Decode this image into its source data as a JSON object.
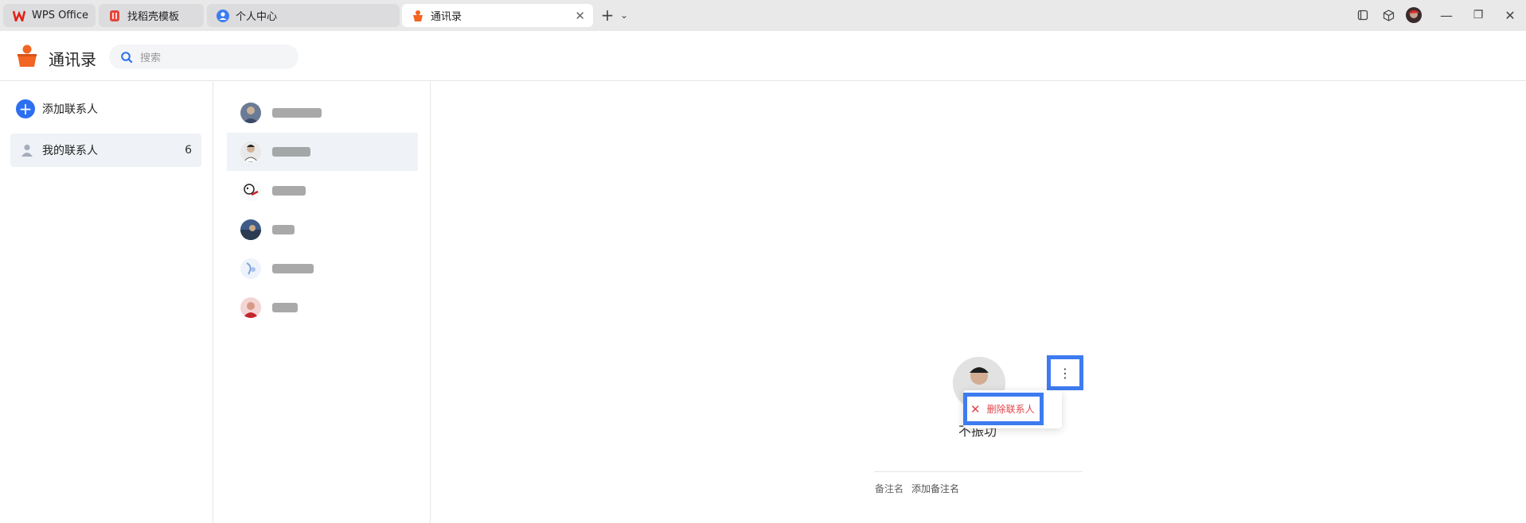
{
  "titlebar": {
    "tabs": [
      {
        "label": "WPS Office",
        "icon": "wps-logo-icon"
      },
      {
        "label": "找稻壳模板",
        "icon": "docer-icon"
      },
      {
        "label": "个人中心",
        "icon": "user-center-icon"
      },
      {
        "label": "通讯录",
        "icon": "contacts-app-icon",
        "active": true
      }
    ],
    "new_tab": "+",
    "dropdown": "⌄",
    "controls": {
      "minimize": "—",
      "restore": "❐",
      "close": "✕"
    }
  },
  "header": {
    "app_title": "通讯录",
    "search_placeholder": "搜索"
  },
  "sidebar": {
    "add_contact": "添加联系人",
    "my_contacts": "我的联系人",
    "my_contacts_count": "6"
  },
  "contacts": {
    "count": 6,
    "selected_index": 1
  },
  "detail": {
    "name": "不振功",
    "more_icon": "⋮",
    "menu": {
      "delete": "删除联系人"
    },
    "remark_label": "备注名",
    "remark_add": "添加备注名"
  },
  "colors": {
    "accent": "#2c6ff0",
    "highlight": "#3d7bf0",
    "danger": "#e0454b",
    "brand_orange": "#f26522"
  }
}
